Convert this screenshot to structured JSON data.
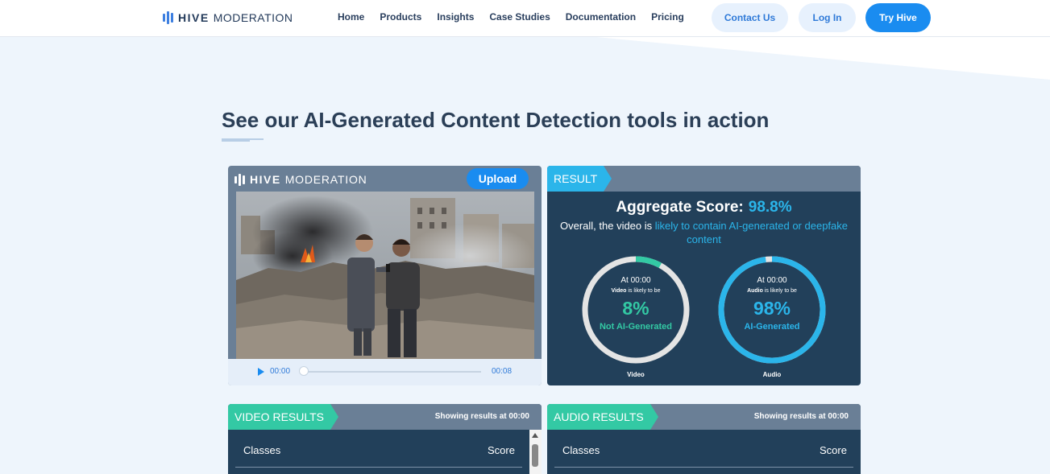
{
  "header": {
    "logo_bold": "HIVE",
    "logo_light": "MODERATION",
    "nav": [
      "Home",
      "Products",
      "Insights",
      "Case Studies",
      "Documentation",
      "Pricing"
    ],
    "contact_label": "Contact Us",
    "login_label": "Log In",
    "try_label": "Try Hive"
  },
  "main": {
    "heading": "See our AI-Generated Content Detection tools in action"
  },
  "player": {
    "logo_bold": "HIVE",
    "logo_light": "MODERATION",
    "upload_label": "Upload",
    "current_time": "00:00",
    "duration": "00:08"
  },
  "result": {
    "tag": "RESULT",
    "aggregate_label": "Aggregate Score:",
    "aggregate_value": "98.8%",
    "overall_prefix": "Overall, the video is",
    "overall_highlight": "likely to contain AI-generated or deepfake content",
    "video_gauge": {
      "at": "At 00:00",
      "subject": "Video",
      "likely": " is likely to be",
      "percent": "8%",
      "label": "Not AI-Generated",
      "name": "Video",
      "fraction": 0.08,
      "color": "#33c9a4"
    },
    "audio_gauge": {
      "at": "At 00:00",
      "subject": "Audio",
      "likely": " is likely to be",
      "percent": "98%",
      "label": "AI-Generated",
      "name": "Audio",
      "fraction": 0.98,
      "color": "#2bb5ea"
    }
  },
  "video_results": {
    "tag": "VIDEO RESULTS",
    "showing_prefix": "Showing results at",
    "showing_time": "00:00",
    "col_classes": "Classes",
    "col_score": "Score"
  },
  "audio_results": {
    "tag": "AUDIO RESULTS",
    "showing_prefix": "Showing results at",
    "showing_time": "00:00",
    "col_classes": "Classes",
    "col_score": "Score"
  }
}
